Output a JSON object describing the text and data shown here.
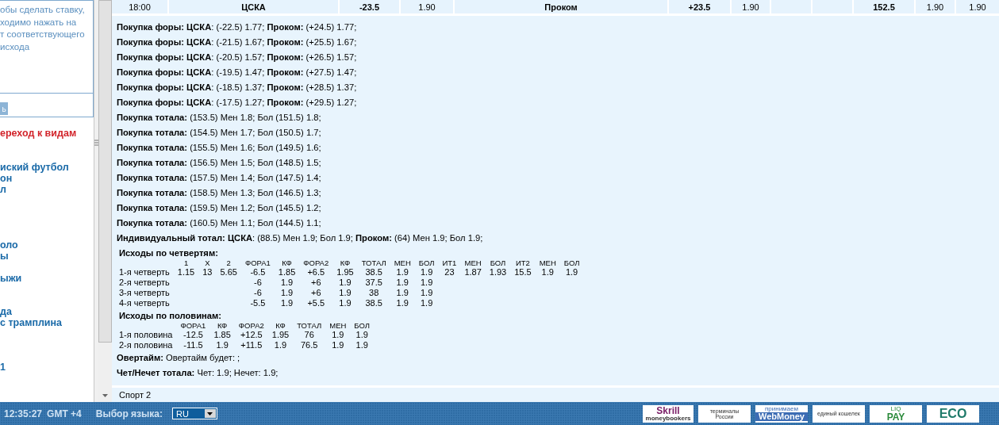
{
  "sidebar": {
    "hint_lines": [
      "обы сделать ставку,",
      "ходимо нажать на",
      "т соответствующего",
      "исхода"
    ],
    "button": "ь",
    "section_link": "ереход к видам",
    "link_groups": [
      [
        "иский футбол",
        "он",
        "л"
      ],
      [
        "оло",
        "ы"
      ],
      [
        "ыжи"
      ],
      [
        "да",
        "с трамплина"
      ],
      [
        "1"
      ]
    ]
  },
  "match_row": [
    {
      "text": "18:00",
      "kind": "plain"
    },
    {
      "text": "ЦСКА",
      "kind": "team"
    },
    {
      "text": "-23.5",
      "kind": "bold"
    },
    {
      "text": "1.90",
      "kind": "plain"
    },
    {
      "text": "Проком",
      "kind": "team"
    },
    {
      "text": "+23.5",
      "kind": "bold"
    },
    {
      "text": "1.90",
      "kind": "plain"
    },
    {
      "kind": "plain"
    },
    {
      "kind": "plain"
    },
    {
      "text": "152.5",
      "kind": "bold"
    },
    {
      "text": "1.90",
      "kind": "plain"
    },
    {
      "text": "1.90",
      "kind": "plain"
    }
  ],
  "bet_lines": [
    "**Покупка форы: ЦСКА**: (-22.5) 1.77; **Проком:** (+24.5) 1.77;",
    "**Покупка форы: ЦСКА**: (-21.5) 1.67; **Проком:** (+25.5) 1.67;",
    "**Покупка форы: ЦСКА**: (-20.5) 1.57; **Проком:** (+26.5) 1.57;",
    "**Покупка форы: ЦСКА**: (-19.5) 1.47; **Проком:** (+27.5) 1.47;",
    "**Покупка форы: ЦСКА**: (-18.5) 1.37; **Проком:** (+28.5) 1.37;",
    "**Покупка форы: ЦСКА**: (-17.5) 1.27; **Проком:** (+29.5) 1.27;",
    "**Покупка тотала:** (153.5) Мен 1.8; Бол (151.5) 1.8;",
    "**Покупка тотала:** (154.5) Мен 1.7; Бол (150.5) 1.7;",
    "**Покупка тотала:** (155.5) Мен 1.6; Бол (149.5) 1.6;",
    "**Покупка тотала:** (156.5) Мен 1.5; Бол (148.5) 1.5;",
    "**Покупка тотала:** (157.5) Мен 1.4; Бол (147.5) 1.4;",
    "**Покупка тотала:** (158.5) Мен 1.3; Бол (146.5) 1.3;",
    "**Покупка тотала:** (159.5) Мен 1.2; Бол (145.5) 1.2;",
    "**Покупка тотала:** (160.5) Мен 1.1; Бол (144.5) 1.1;",
    "**Индивидуальный тотал: ЦСКА**: (88.5) Мен 1.9; Бол 1.9; **Проком:** (64) Мен 1.9; Бол 1.9;"
  ],
  "tables": [
    {
      "title": "Исходы по четвертям:",
      "columns": [
        null,
        "1",
        "X",
        "2",
        "ФОРА1",
        "КФ",
        "ФОРА2",
        "КФ",
        "ТОТАЛ",
        "МЕН",
        "БОЛ",
        "ИТ1",
        "МЕН",
        "БОЛ",
        "ИТ2",
        "МЕН",
        "БОЛ"
      ],
      "rows": [
        [
          "1-я четверть",
          "1.15",
          "13",
          "5.65",
          "-6.5",
          "1.85",
          "+6.5",
          "1.95",
          "38.5",
          "1.9",
          "1.9",
          "23",
          "1.87",
          "1.93",
          "15.5",
          "1.9",
          "1.9"
        ],
        [
          "2-я четверть",
          null,
          null,
          null,
          "-6",
          "1.9",
          "+6",
          "1.9",
          "37.5",
          "1.9",
          "1.9",
          null,
          null,
          null,
          null,
          null,
          null
        ],
        [
          "3-я четверть",
          null,
          null,
          null,
          "-6",
          "1.9",
          "+6",
          "1.9",
          "38",
          "1.9",
          "1.9",
          null,
          null,
          null,
          null,
          null,
          null
        ],
        [
          "4-я четверть",
          null,
          null,
          null,
          "-5.5",
          "1.9",
          "+5.5",
          "1.9",
          "38.5",
          "1.9",
          "1.9",
          null,
          null,
          null,
          null,
          null,
          null
        ]
      ]
    },
    {
      "title": "Исходы по половинам:",
      "columns": [
        null,
        "ФОРА1",
        "КФ",
        "ФОРА2",
        "КФ",
        "ТОТАЛ",
        "МЕН",
        "БОЛ"
      ],
      "rows": [
        [
          "1-я половина",
          "-12.5",
          "1.85",
          "+12.5",
          "1.95",
          "76",
          "1.9",
          "1.9"
        ],
        [
          "2-я половина",
          "-11.5",
          "1.9",
          "+11.5",
          "1.9",
          "76.5",
          "1.9",
          "1.9"
        ]
      ]
    }
  ],
  "extra_lines": [
    "**Овертайм:** Овертайм будет: ;",
    "**Чет/Нечет тотала:** Чет: 1.9; Нечет: 1.9;"
  ],
  "sport_label": "Спорт 2",
  "footer": {
    "time": "12:35:27",
    "timezone": "GMT +4",
    "language_label": "Выбор языка:",
    "language_value": "RU",
    "logos": [
      {
        "kind": "skrill",
        "lines": [
          "Skrill",
          "moneybookers"
        ]
      },
      {
        "kind": "terminals",
        "lines": [
          "терминалы",
          "России"
        ]
      },
      {
        "kind": "webmoney",
        "lines": [
          "принимаем",
          "WebMoney"
        ]
      },
      {
        "kind": "wallet",
        "lines": [
          "единый кошелек"
        ]
      },
      {
        "kind": "liqpay",
        "lines": [
          "LIQ",
          "PAY"
        ]
      },
      {
        "kind": "eco",
        "lines": [
          "ECO"
        ]
      }
    ]
  }
}
